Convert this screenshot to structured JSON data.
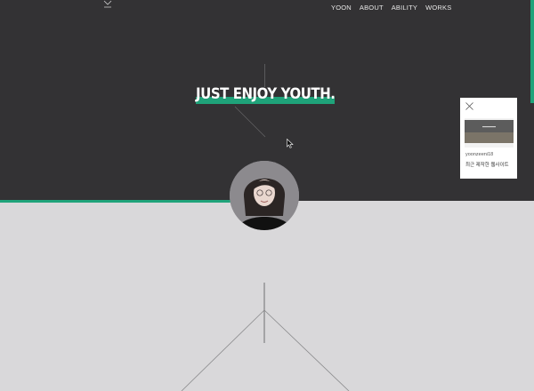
{
  "theme": {
    "dark": "#333234",
    "light": "#d9d8da",
    "accent": "#1fa37a"
  },
  "logo": {
    "icon": "stylized-y-logo-icon"
  },
  "nav": {
    "items": [
      "YOON",
      "ABOUT",
      "ABILITY",
      "WORKS"
    ]
  },
  "hero": {
    "headline": "JUST ENJOY YOUTH."
  },
  "profile": {
    "icon": "profile-photo-avatar"
  },
  "popup": {
    "close_icon": "close-icon",
    "username": "yoonzeeni18",
    "description": "최근 제작한 웹사이트"
  }
}
